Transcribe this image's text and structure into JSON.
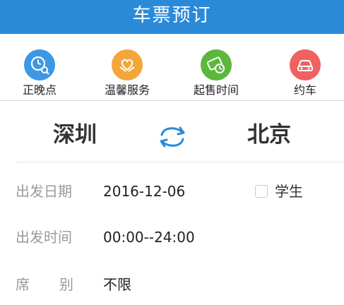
{
  "header": {
    "title": "车票预订"
  },
  "shortcuts": [
    {
      "label": "正晚点",
      "icon": "clock-search-icon",
      "color": "#3d97e3"
    },
    {
      "label": "温馨服务",
      "icon": "heart-hands-icon",
      "color": "#f3a63a"
    },
    {
      "label": "起售时间",
      "icon": "ticket-clock-icon",
      "color": "#5cb73b"
    },
    {
      "label": "约车",
      "icon": "car-icon",
      "color": "#f06162"
    }
  ],
  "route": {
    "from": "深圳",
    "to": "北京",
    "swap_icon": "swap-arrows-icon",
    "accent": "#2b8ad8"
  },
  "form": {
    "date": {
      "label": "出发日期",
      "value": "2016-12-06"
    },
    "time": {
      "label": "出发时间",
      "value": "00:00--24:00"
    },
    "seat": {
      "label_part1": "席",
      "label_part2": "别",
      "value": "不限"
    },
    "student": {
      "label": "学生",
      "checked": false
    }
  }
}
